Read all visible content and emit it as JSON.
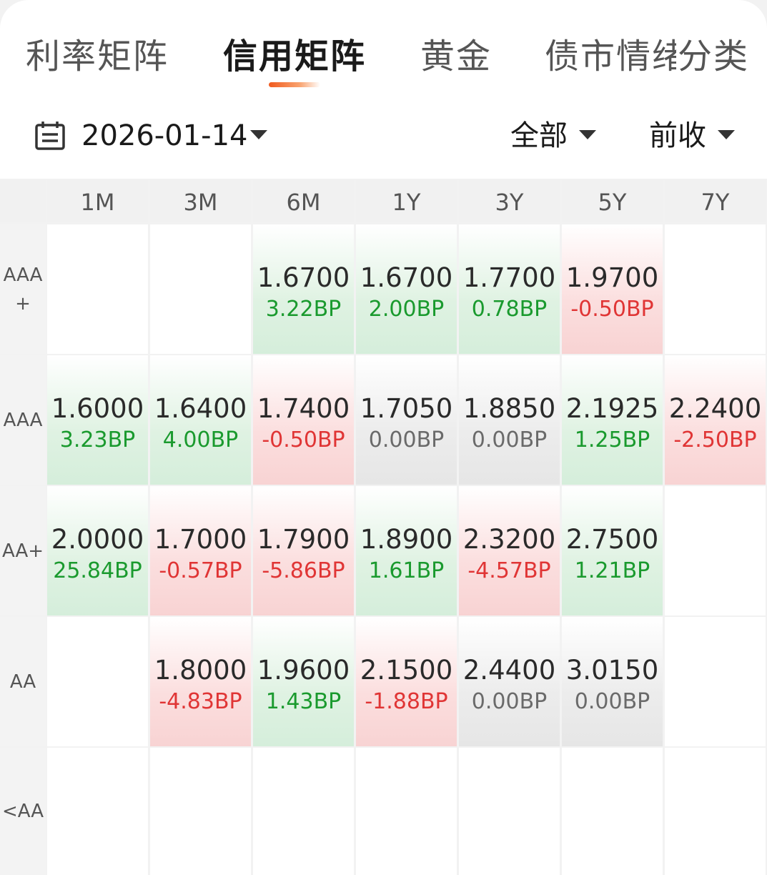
{
  "tabs": [
    {
      "label": "利率矩阵",
      "active": false
    },
    {
      "label": "信用矩阵",
      "active": true
    },
    {
      "label": "黄金",
      "active": false
    },
    {
      "label": "债市情绪",
      "active": false
    },
    {
      "label": "分类",
      "active": false
    }
  ],
  "filter": {
    "date": "2026-01-14",
    "scope": "全部",
    "compare": "前收"
  },
  "matrix": {
    "columns": [
      "1M",
      "3M",
      "6M",
      "1Y",
      "3Y",
      "5Y",
      "7Y"
    ],
    "rows": [
      {
        "label": "AAA+",
        "cells": [
          {
            "value": "",
            "change": "",
            "trend": "none"
          },
          {
            "value": "",
            "change": "",
            "trend": "none"
          },
          {
            "value": "1.6700",
            "change": "3.22BP",
            "trend": "up"
          },
          {
            "value": "1.6700",
            "change": "2.00BP",
            "trend": "up"
          },
          {
            "value": "1.7700",
            "change": "0.78BP",
            "trend": "up"
          },
          {
            "value": "1.9700",
            "change": "-0.50BP",
            "trend": "down"
          },
          {
            "value": "",
            "change": "",
            "trend": "none"
          }
        ]
      },
      {
        "label": "AAA",
        "cells": [
          {
            "value": "1.6000",
            "change": "3.23BP",
            "trend": "up"
          },
          {
            "value": "1.6400",
            "change": "4.00BP",
            "trend": "up"
          },
          {
            "value": "1.7400",
            "change": "-0.50BP",
            "trend": "down"
          },
          {
            "value": "1.7050",
            "change": "0.00BP",
            "trend": "flat"
          },
          {
            "value": "1.8850",
            "change": "0.00BP",
            "trend": "flat"
          },
          {
            "value": "2.1925",
            "change": "1.25BP",
            "trend": "up"
          },
          {
            "value": "2.2400",
            "change": "-2.50BP",
            "trend": "down"
          }
        ]
      },
      {
        "label": "AA+",
        "cells": [
          {
            "value": "2.0000",
            "change": "25.84BP",
            "trend": "up"
          },
          {
            "value": "1.7000",
            "change": "-0.57BP",
            "trend": "down"
          },
          {
            "value": "1.7900",
            "change": "-5.86BP",
            "trend": "down"
          },
          {
            "value": "1.8900",
            "change": "1.61BP",
            "trend": "up"
          },
          {
            "value": "2.3200",
            "change": "-4.57BP",
            "trend": "down"
          },
          {
            "value": "2.7500",
            "change": "1.21BP",
            "trend": "up"
          },
          {
            "value": "",
            "change": "",
            "trend": "none"
          }
        ]
      },
      {
        "label": "AA",
        "cells": [
          {
            "value": "",
            "change": "",
            "trend": "none"
          },
          {
            "value": "1.8000",
            "change": "-4.83BP",
            "trend": "down"
          },
          {
            "value": "1.9600",
            "change": "1.43BP",
            "trend": "up"
          },
          {
            "value": "2.1500",
            "change": "-1.88BP",
            "trend": "down"
          },
          {
            "value": "2.4400",
            "change": "0.00BP",
            "trend": "flat"
          },
          {
            "value": "3.0150",
            "change": "0.00BP",
            "trend": "flat"
          },
          {
            "value": "",
            "change": "",
            "trend": "none"
          }
        ]
      },
      {
        "label": "<AA",
        "cells": [
          {
            "value": "",
            "change": "",
            "trend": "none"
          },
          {
            "value": "",
            "change": "",
            "trend": "none"
          },
          {
            "value": "",
            "change": "",
            "trend": "none"
          },
          {
            "value": "",
            "change": "",
            "trend": "none"
          },
          {
            "value": "",
            "change": "",
            "trend": "none"
          },
          {
            "value": "",
            "change": "",
            "trend": "none"
          },
          {
            "value": "",
            "change": "",
            "trend": "none"
          }
        ]
      }
    ]
  },
  "colors": {
    "up": "#1a9a2e",
    "down": "#e03535",
    "flat": "#6a6a6a",
    "accent": "#f05a1e"
  },
  "icons": {
    "calendar": "calendar-icon",
    "dropdown": "caret-down-icon"
  }
}
